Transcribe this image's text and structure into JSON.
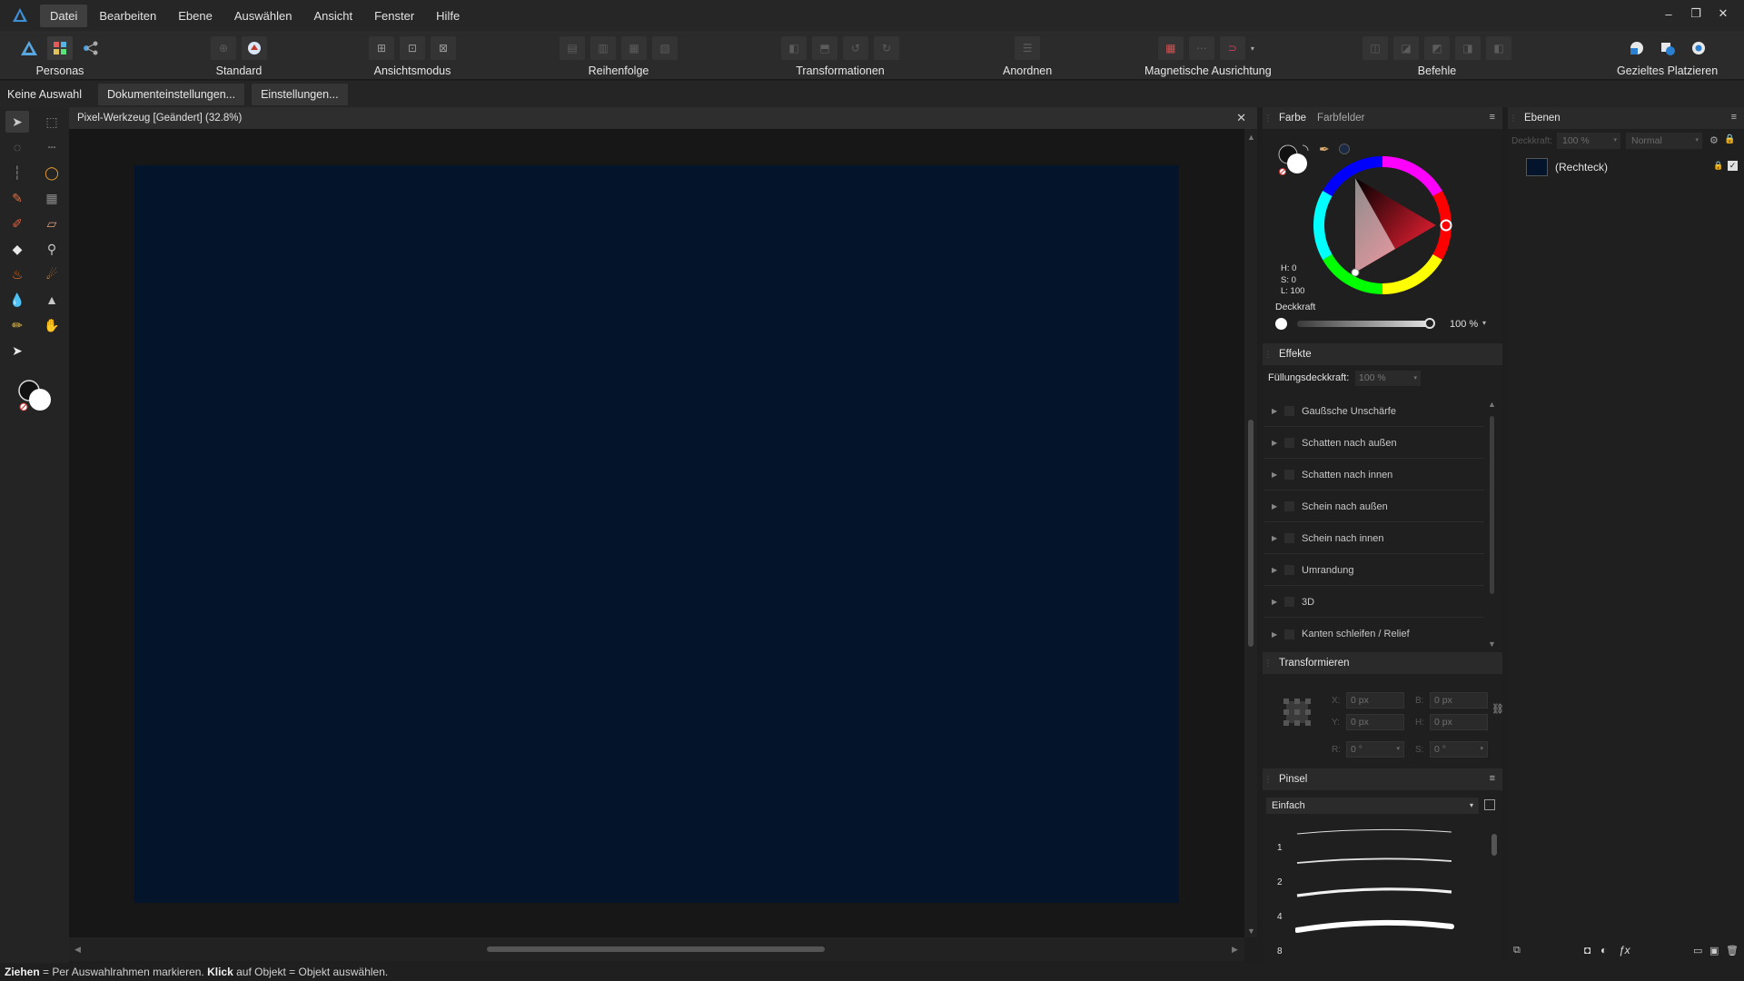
{
  "menubar": {
    "items": [
      "Datei",
      "Bearbeiten",
      "Ebene",
      "Auswählen",
      "Ansicht",
      "Fenster",
      "Hilfe"
    ],
    "active_index": 0,
    "window_controls": [
      "–",
      "❐",
      "✕"
    ]
  },
  "toolbar": {
    "groups": [
      {
        "label": "Personas"
      },
      {
        "label": "Standard"
      },
      {
        "label": "Ansichtsmodus"
      },
      {
        "label": "Reihenfolge"
      },
      {
        "label": "Transformationen"
      },
      {
        "label": "Anordnen"
      },
      {
        "label": "Magnetische Ausrichtung"
      },
      {
        "label": "Befehle"
      },
      {
        "label": "Gezieltes Platzieren"
      }
    ]
  },
  "contextbar": {
    "selection_text": "Keine Auswahl",
    "document_settings": "Dokumenteinstellungen...",
    "settings": "Einstellungen..."
  },
  "document": {
    "title": "Pixel-Werkzeug [Geändert] (32.8%)",
    "close": "✕",
    "artboard_color": "#04142b"
  },
  "color_panel": {
    "tabs": [
      "Farbe",
      "Farbfelder"
    ],
    "h": "H: 0",
    "s": "S: 0",
    "l": "L: 100",
    "opacity_label": "Deckkraft",
    "opacity_value": "100 %"
  },
  "effects_panel": {
    "title": "Effekte",
    "fill_opacity_label": "Füllungsdeckkraft:",
    "fill_opacity_value": "100 %",
    "effects": [
      "Gaußsche Unschärfe",
      "Schatten nach außen",
      "Schatten nach innen",
      "Schein nach außen",
      "Schein nach innen",
      "Umrandung",
      "3D",
      "Kanten schleifen / Relief"
    ]
  },
  "transform_panel": {
    "title": "Transformieren",
    "x": "0 px",
    "y": "0 px",
    "w": "0 px",
    "h": "0 px",
    "r": "0 °",
    "s": "0 °",
    "labels": {
      "x": "X:",
      "y": "Y:",
      "w": "B:",
      "h": "H:",
      "r": "R:",
      "s": "S:"
    }
  },
  "brush_panel": {
    "title": "Pinsel",
    "category": "Einfach",
    "sizes": [
      "1",
      "2",
      "4",
      "8"
    ]
  },
  "layers_panel": {
    "title": "Ebenen",
    "opacity_label": "Deckkraft:",
    "opacity_value": "100 %",
    "blend_mode": "Normal",
    "layer_name": "(Rechteck)"
  },
  "statusbar": {
    "drag_key": "Ziehen",
    "drag_text": " = Per Auswahlrahmen markieren. ",
    "click_key": "Klick",
    "click_text": " auf Objekt = Objekt auswählen."
  },
  "colors": {
    "accent": "#4a9ad8",
    "artboard": "#04142b"
  }
}
